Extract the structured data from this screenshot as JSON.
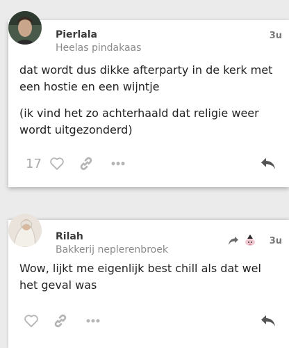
{
  "posts": [
    {
      "username": "Pierlala",
      "subtitle": "Heelas pindakaas",
      "time": "3u",
      "paragraphs": [
        "dat wordt dus dikke afterparty in de kerk met een hostie en een wijntje",
        "(ik vind het zo achterhaald dat religie weer wordt uitgezonderd)"
      ],
      "like_count": "17",
      "icons": [
        "heart-icon",
        "link-icon",
        "more-icon",
        "reply-icon"
      ]
    },
    {
      "username": "Rilah",
      "subtitle": "Bakkerij neplerenbroek",
      "time": "3u",
      "paragraphs": [
        "Wow, lijkt me eigenlijk best chill als dat wel het geval was"
      ],
      "icons": [
        "heart-icon",
        "link-icon",
        "more-icon",
        "reply-icon",
        "reply-to-arrow-icon"
      ]
    }
  ],
  "colors": {
    "icon": "#b5b5b5",
    "reply_icon": "#555555",
    "background": "#ebebeb"
  }
}
